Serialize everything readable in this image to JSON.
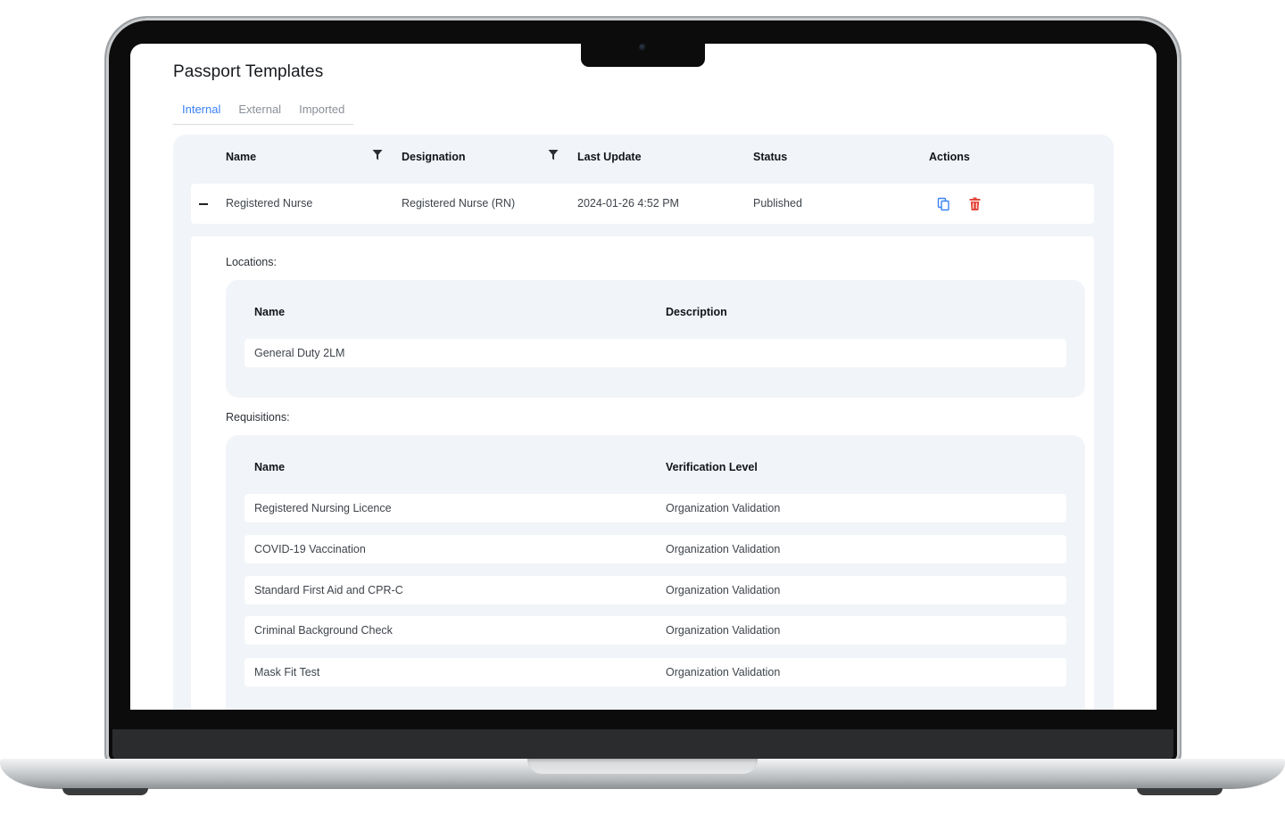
{
  "page": {
    "title": "Passport Templates"
  },
  "tabs": [
    {
      "label": "Internal",
      "active": true
    },
    {
      "label": "External",
      "active": false
    },
    {
      "label": "Imported",
      "active": false
    }
  ],
  "table": {
    "columns": {
      "name": "Name",
      "designation": "Designation",
      "last_update": "Last Update",
      "status": "Status",
      "actions": "Actions"
    },
    "row": {
      "name": "Registered Nurse",
      "designation": "Registered Nurse (RN)",
      "last_update": "2024-01-26 4:52 PM",
      "status": "Published",
      "actions": [
        "copy-icon",
        "trash-icon"
      ]
    }
  },
  "locations": {
    "label": "Locations:",
    "columns": {
      "name": "Name",
      "description": "Description"
    },
    "rows": [
      {
        "name": "General Duty 2LM",
        "description": ""
      }
    ]
  },
  "requisitions": {
    "label": "Requisitions:",
    "columns": {
      "name": "Name",
      "verification_level": "Verification Level"
    },
    "rows": [
      {
        "name": "Registered Nursing Licence",
        "verification_level": "Organization Validation"
      },
      {
        "name": "COVID-19 Vaccination",
        "verification_level": "Organization Validation"
      },
      {
        "name": "Standard First Aid and CPR-C",
        "verification_level": "Organization Validation"
      },
      {
        "name": "Criminal Background Check",
        "verification_level": "Organization Validation"
      },
      {
        "name": "Mask Fit Test",
        "verification_level": "Organization Validation"
      }
    ]
  },
  "colors": {
    "accent": "#3a82f7",
    "danger": "#e5483c",
    "panel": "#f1f4f8"
  }
}
